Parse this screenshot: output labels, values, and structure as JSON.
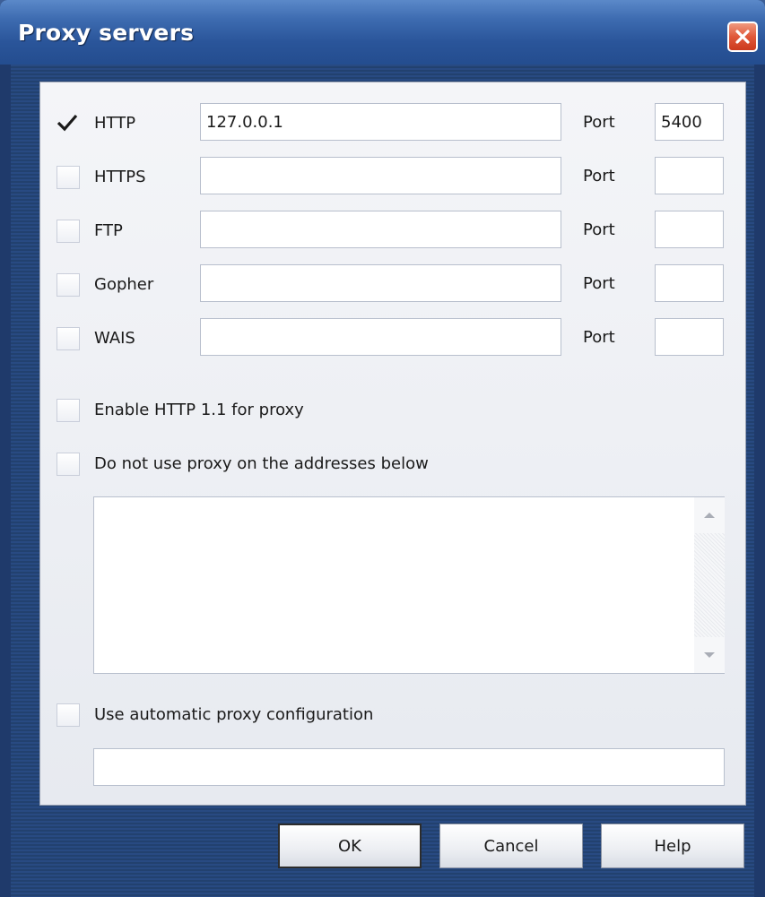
{
  "window": {
    "title": "Proxy servers"
  },
  "protocols": [
    {
      "label": "HTTP",
      "checked": true,
      "address": "127.0.0.1",
      "port_label": "Port",
      "port": "5400"
    },
    {
      "label": "HTTPS",
      "checked": false,
      "address": "",
      "port_label": "Port",
      "port": ""
    },
    {
      "label": "FTP",
      "checked": false,
      "address": "",
      "port_label": "Port",
      "port": ""
    },
    {
      "label": "Gopher",
      "checked": false,
      "address": "",
      "port_label": "Port",
      "port": ""
    },
    {
      "label": "WAIS",
      "checked": false,
      "address": "",
      "port_label": "Port",
      "port": ""
    }
  ],
  "options": {
    "enable_http11_label": "Enable HTTP 1.1 for proxy",
    "enable_http11_checked": false,
    "bypass_label": "Do not use proxy on the addresses below",
    "bypass_checked": false,
    "bypass_addresses": "",
    "auto_config_label": "Use automatic proxy configuration",
    "auto_config_checked": false,
    "auto_config_url": ""
  },
  "buttons": {
    "ok": "OK",
    "cancel": "Cancel",
    "help": "Help"
  },
  "icons": {
    "close": "close-icon",
    "check": "checkmark-icon",
    "scroll_up": "arrow-up-icon",
    "scroll_down": "arrow-down-icon"
  },
  "colors": {
    "title_bar": "#2a559a",
    "close_button": "#e0583a",
    "panel": "#eef0f4"
  }
}
